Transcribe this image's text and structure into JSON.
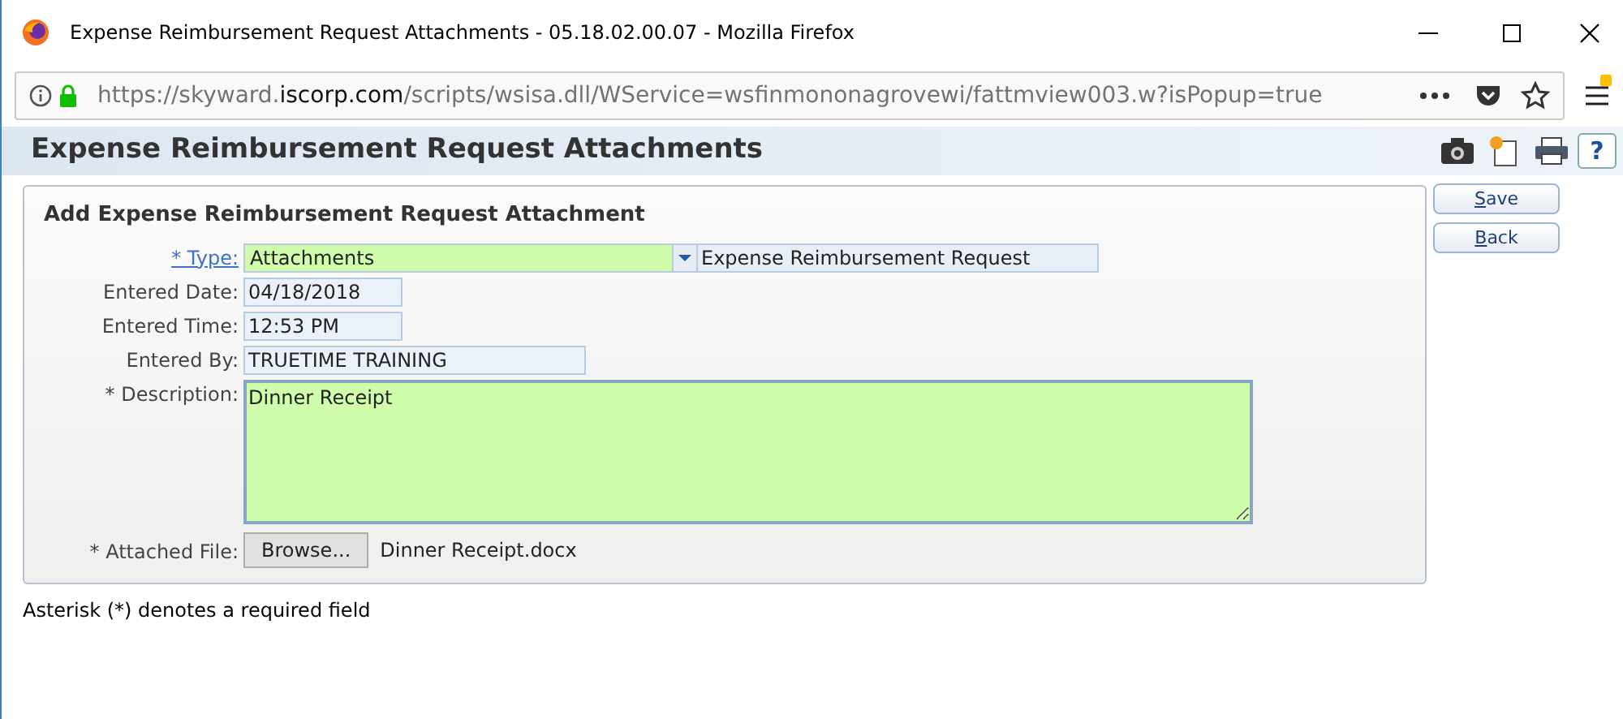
{
  "window": {
    "title": "Expense Reimbursement Request Attachments - 05.18.02.00.07 - Mozilla Firefox"
  },
  "url": {
    "before": "https://skyward.",
    "domain": "iscorp.com",
    "after": "/scripts/wsisa.dll/WService=wsfinmononagrovewi/fattmview003.w?isPopup=true"
  },
  "page_title": "Expense Reimbursement Request Attachments",
  "help_label": "?",
  "form": {
    "title": "Add Expense Reimbursement Request Attachment",
    "type": {
      "label": "* Type:",
      "value": "Attachments",
      "description": "Expense Reimbursement Request"
    },
    "fields": [
      {
        "label": "Entered Date:",
        "value": "04/18/2018"
      },
      {
        "label": "Entered Time:",
        "value": "12:53 PM"
      },
      {
        "label": "Entered By:",
        "value": "TRUETIME TRAINING"
      }
    ],
    "description": {
      "label": "* Description:",
      "value": "Dinner Receipt"
    },
    "attachment": {
      "label": "* Attached File:",
      "button": "Browse...",
      "file": "Dinner Receipt.docx"
    }
  },
  "buttons": [
    {
      "key": "S",
      "rest": "ave"
    },
    {
      "key": "B",
      "rest": "ack"
    }
  ],
  "footnote": "Asterisk (*) denotes a required field"
}
